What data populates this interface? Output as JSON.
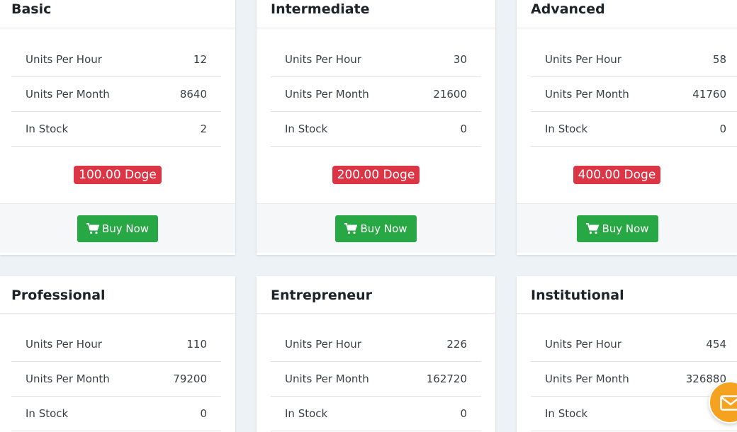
{
  "plans": [
    {
      "name": "Basic",
      "stats": [
        {
          "label": "Units Per Hour",
          "value": "12"
        },
        {
          "label": "Units Per Month",
          "value": "8640"
        },
        {
          "label": "In Stock",
          "value": "2"
        }
      ],
      "price": "100.00 Doge",
      "button": "Buy Now"
    },
    {
      "name": "Intermediate",
      "stats": [
        {
          "label": "Units Per Hour",
          "value": "30"
        },
        {
          "label": "Units Per Month",
          "value": "21600"
        },
        {
          "label": "In Stock",
          "value": "0"
        }
      ],
      "price": "200.00 Doge",
      "button": "Buy Now"
    },
    {
      "name": "Advanced",
      "stats": [
        {
          "label": "Units Per Hour",
          "value": "58"
        },
        {
          "label": "Units Per Month",
          "value": "41760"
        },
        {
          "label": "In Stock",
          "value": "0"
        }
      ],
      "price": "400.00 Doge",
      "button": "Buy Now"
    },
    {
      "name": "Professional",
      "stats": [
        {
          "label": "Units Per Hour",
          "value": "110"
        },
        {
          "label": "Units Per Month",
          "value": "79200"
        },
        {
          "label": "In Stock",
          "value": "0"
        }
      ]
    },
    {
      "name": "Entrepreneur",
      "stats": [
        {
          "label": "Units Per Hour",
          "value": "226"
        },
        {
          "label": "Units Per Month",
          "value": "162720"
        },
        {
          "label": "In Stock",
          "value": "0"
        }
      ]
    },
    {
      "name": "Institutional",
      "stats": [
        {
          "label": "Units Per Hour",
          "value": "454"
        },
        {
          "label": "Units Per Month",
          "value": "326880"
        },
        {
          "label": "In Stock",
          "value": ""
        }
      ]
    }
  ],
  "colors": {
    "price_badge": "#dc3545",
    "buy_button": "#28a745",
    "chat_button": "#f4a21f"
  },
  "icons": {
    "buy": "shopping-cart-icon",
    "chat": "envelope-icon"
  }
}
